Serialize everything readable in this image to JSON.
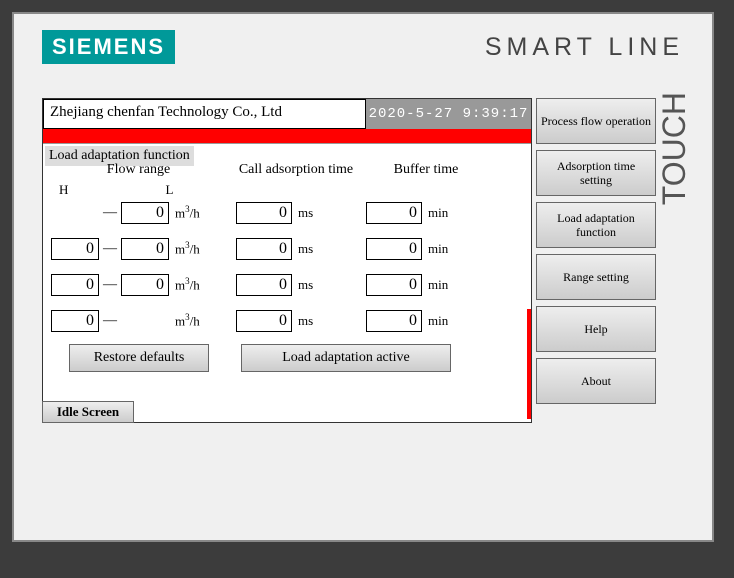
{
  "branding": {
    "logo": "SIEMENS",
    "product_line": "SMART LINE",
    "touch_label": "TOUCH"
  },
  "header": {
    "company": "Zhejiang chenfan Technology Co., Ltd",
    "datetime": "2020-5-27 9:39:17"
  },
  "section": {
    "title": "Load adaptation function",
    "col_flow": "Flow range",
    "col_call": "Call adsorption time",
    "col_buf": "Buffer time",
    "label_H": "H",
    "label_L": "L",
    "unit_flow_pre": "m",
    "unit_flow_sup": "3",
    "unit_flow_post": "/h",
    "unit_ms": "ms",
    "unit_min": "min"
  },
  "rows": [
    {
      "h": "",
      "l": "0",
      "call": "0",
      "buf": "0"
    },
    {
      "h": "0",
      "l": "0",
      "call": "0",
      "buf": "0"
    },
    {
      "h": "0",
      "l": "0",
      "call": "0",
      "buf": "0"
    },
    {
      "h": "0",
      "l": "",
      "call": "0",
      "buf": "0"
    }
  ],
  "buttons": {
    "restore": "Restore defaults",
    "active": "Load adaptation active",
    "idle": "Idle Screen"
  },
  "side_menu": [
    "Process flow operation",
    "Adsorption time setting",
    "Load adaptation function",
    "Range setting",
    "Help",
    "About"
  ]
}
